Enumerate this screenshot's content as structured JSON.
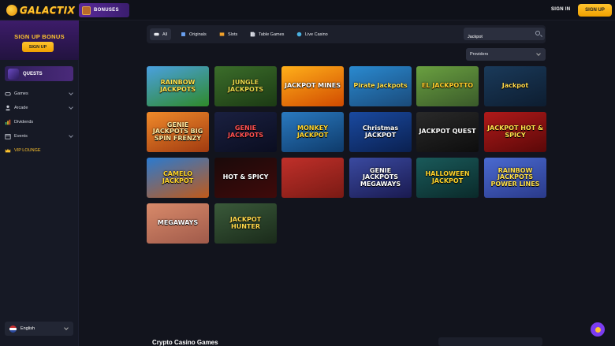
{
  "header": {
    "logo_text": "GALACTIX",
    "bonuses_label": "BONUSES",
    "signin_label": "SIGN IN",
    "signup_label": "SIGN UP"
  },
  "sidebar": {
    "promo_title": "SIGN UP BONUS",
    "promo_button": "SIGN UP",
    "quests_label": "QUESTS",
    "items": [
      {
        "label": "Games",
        "icon": "gamepad-icon",
        "has_chevron": true
      },
      {
        "label": "Arcade",
        "icon": "joystick-icon",
        "has_chevron": true
      },
      {
        "label": "Dividends",
        "icon": "bar-chart-icon",
        "has_chevron": false
      },
      {
        "label": "Events",
        "icon": "calendar-icon",
        "has_chevron": true
      },
      {
        "label": "VIP LOUNGE",
        "icon": "crown-icon",
        "has_chevron": false
      }
    ],
    "language": "English"
  },
  "filters": {
    "tabs": [
      {
        "label": "All",
        "icon": "gamepad-icon",
        "active": true
      },
      {
        "label": "Originals",
        "icon": "cube-icon",
        "active": false
      },
      {
        "label": "Slots",
        "icon": "slot-icon",
        "active": false
      },
      {
        "label": "Table Games",
        "icon": "cards-icon",
        "active": false
      },
      {
        "label": "Live Casino",
        "icon": "globe-icon",
        "active": false
      }
    ],
    "search_value": "Jackpot",
    "providers_label": "Providers"
  },
  "games": [
    {
      "title": "RAINBOW JACKPOTS",
      "bg1": "#4aa0e0",
      "bg2": "#2f8a2a",
      "color": "#ffe04a"
    },
    {
      "title": "JUNGLE JACKPOTS",
      "bg1": "#3b6d2a",
      "bg2": "#1c3a14",
      "color": "#e9d84a"
    },
    {
      "title": "JACKPOT MINES",
      "bg1": "#ffb01a",
      "bg2": "#d14a00",
      "color": "#ffffff"
    },
    {
      "title": "Pirate Jackpots",
      "bg1": "#2a8ad0",
      "bg2": "#1a4a7a",
      "color": "#ffe04a"
    },
    {
      "title": "EL JACKPOTTO",
      "bg1": "#6aa040",
      "bg2": "#3a5a2a",
      "color": "#ffcc2a"
    },
    {
      "title": "Jackpot",
      "bg1": "#1a3a5a",
      "bg2": "#0d1d30",
      "color": "#ffd84a"
    },
    {
      "title": "GENIE JACKPOTS BIG SPIN FRENZY",
      "bg1": "#f08a2a",
      "bg2": "#a03a10",
      "color": "#ffe9a0"
    },
    {
      "title": "GENIE JACKPOTS",
      "bg1": "#1a2040",
      "bg2": "#0a0d20",
      "color": "#ff5050"
    },
    {
      "title": "MONKEY JACKPOT",
      "bg1": "#2a7ac0",
      "bg2": "#0e3a6a",
      "color": "#ffd42a"
    },
    {
      "title": "Christmas JACKPOT",
      "bg1": "#1a4aa0",
      "bg2": "#0a2050",
      "color": "#ffffff"
    },
    {
      "title": "JACKPOT QUEST",
      "bg1": "#2a2a2a",
      "bg2": "#0d0d0d",
      "color": "#ffffff"
    },
    {
      "title": "JACKPOT HOT & SPICY",
      "bg1": "#b01a1a",
      "bg2": "#5a0808",
      "color": "#ffe04a"
    },
    {
      "title": "CAMELO JACKPOT",
      "bg1": "#2a7ad0",
      "bg2": "#c05a1a",
      "color": "#ffd42a"
    },
    {
      "title": "HOT & SPICY",
      "bg1": "#1a0a0a",
      "bg2": "#400a0a",
      "color": "#ffffff"
    },
    {
      "title": "",
      "bg1": "#c0302a",
      "bg2": "#7a1a14",
      "color": "#ffffff"
    },
    {
      "title": "GENIE JACKPOTS MEGAWAYS",
      "bg1": "#3a4aa0",
      "bg2": "#1a1a50",
      "color": "#ffffff"
    },
    {
      "title": "HALLOWEEN JACKPOT",
      "bg1": "#1a5a5a",
      "bg2": "#0a2a2a",
      "color": "#ffd42a"
    },
    {
      "title": "RAINBOW JACKPOTS POWER LINES",
      "bg1": "#4a6ad0",
      "bg2": "#2a3a8a",
      "color": "#ffe04a"
    },
    {
      "title": "MEGAWAYS",
      "bg1": "#d88a6a",
      "bg2": "#a05a4a",
      "color": "#ffffff"
    },
    {
      "title": "JACKPOT HUNTER",
      "bg1": "#3a5a3a",
      "bg2": "#1a2a1a",
      "color": "#ffd84a"
    }
  ],
  "footer": {
    "title": "Crypto Casino Games"
  },
  "colors": {
    "accent": "#ffc42e",
    "purple": "#7b3cf0",
    "background": "#12141d"
  }
}
